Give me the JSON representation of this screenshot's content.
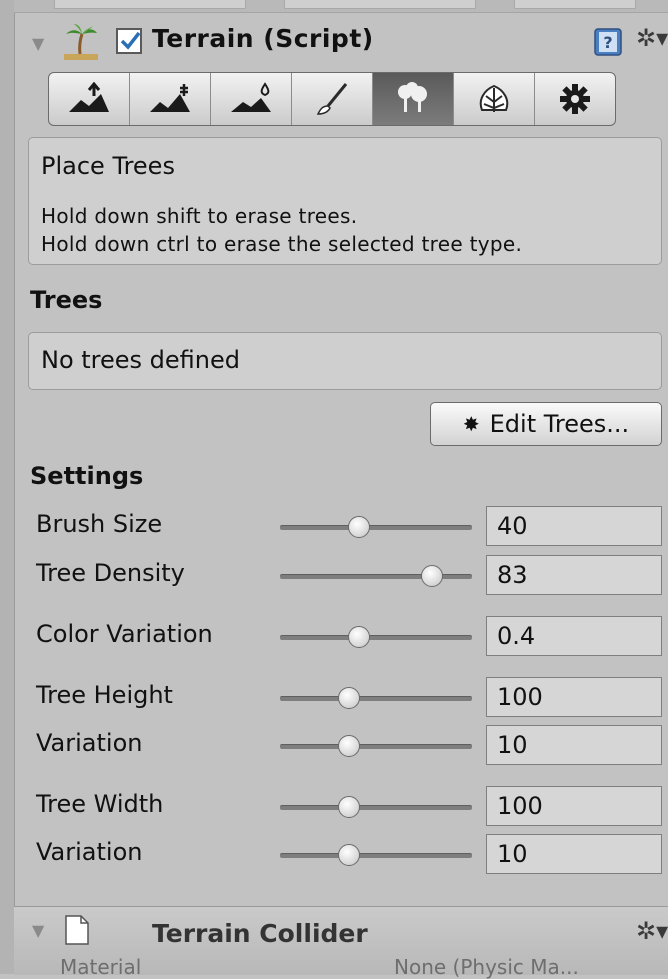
{
  "component": {
    "title": "Terrain (Script)",
    "enabled": true,
    "icon": "palm-tree-icon"
  },
  "toolbar": {
    "tools": [
      {
        "name": "raise-lower-terrain",
        "icon": "raise-terrain-icon",
        "active": false
      },
      {
        "name": "paint-height",
        "icon": "paint-height-icon",
        "active": false
      },
      {
        "name": "smooth-height",
        "icon": "smooth-height-icon",
        "active": false
      },
      {
        "name": "paint-texture",
        "icon": "brush-icon",
        "active": false
      },
      {
        "name": "place-trees",
        "icon": "tree-icon",
        "active": true
      },
      {
        "name": "paint-details",
        "icon": "detail-icon",
        "active": false
      },
      {
        "name": "terrain-settings",
        "icon": "gear-icon",
        "active": false
      }
    ]
  },
  "info": {
    "title": "Place Trees",
    "line1": "Hold down shift to erase trees.",
    "line2": "Hold down ctrl to erase the selected tree type."
  },
  "trees": {
    "heading": "Trees",
    "empty_text": "No trees defined",
    "edit_button": "Edit Trees..."
  },
  "settings": {
    "heading": "Settings",
    "rows": [
      {
        "label": "Brush Size",
        "value": "40",
        "slider": 0.41
      },
      {
        "label": "Tree Density",
        "value": "83",
        "slider": 0.79
      },
      {
        "label": "Color Variation",
        "value": "0.4",
        "slider": 0.41
      },
      {
        "label": "Tree Height",
        "value": "100",
        "slider": 0.36
      },
      {
        "label": "Variation",
        "value": "10",
        "slider": 0.36
      },
      {
        "label": "Tree Width",
        "value": "100",
        "slider": 0.36
      },
      {
        "label": "Variation",
        "value": "10",
        "slider": 0.36
      }
    ]
  },
  "footer": {
    "title": "Terrain Collider",
    "sub_left": "Material",
    "sub_right": "None (Physic Ma..."
  },
  "colors": {
    "panel": "#c2c2c2",
    "checkbox_tick": "#2a6fb5",
    "active_tool": "#5a5a5a"
  }
}
